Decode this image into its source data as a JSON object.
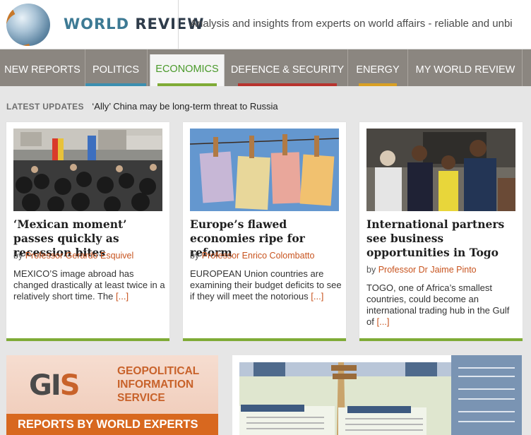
{
  "header": {
    "logo_part1": "WORLD",
    "logo_part2": "REVIEW",
    "tagline": "Analysis and insights from experts on world affairs - reliable and unbi"
  },
  "nav": {
    "items": [
      {
        "label": "NEW REPORTS"
      },
      {
        "label": "POLITICS",
        "bar_color": "#3b8fb0"
      },
      {
        "label": "ECONOMICS",
        "bar_color": "#7fab36"
      },
      {
        "label": "DEFENCE & SECURITY",
        "bar_color": "#b8332e"
      },
      {
        "label": "ENERGY",
        "bar_color": "#d9a023"
      },
      {
        "label": "MY WORLD REVIEW"
      }
    ]
  },
  "latest": {
    "label": "LATEST UPDATES",
    "headline": "‘Ally’ China may be long-term threat to Russia"
  },
  "cards": [
    {
      "title": "‘Mexican moment’ passes quickly as recession bites",
      "by": "by",
      "author": "Professor Gerardo Esquivel",
      "excerpt": "MEXICO’S image abroad has changed drastically at least twice in a relatively short time. The",
      "more": "[...]"
    },
    {
      "title": "Europe’s flawed economies ripe for reform",
      "by": "by",
      "author": "Professor Enrico Colombatto",
      "excerpt": "EUROPEAN Union countries are examining their budget deficits to see if they will meet the notorious",
      "more": "[...]"
    },
    {
      "title": "International partners see business opportunities in Togo",
      "by": "by",
      "author": "Professor Dr Jaime Pinto",
      "excerpt": "TOGO, one of Africa’s smallest countries, could become an international trading hub in the Gulf of",
      "more": "[...]"
    }
  ],
  "banners": {
    "gis_logo_a": "GI",
    "gis_logo_b": "S",
    "gis_line1": "GEOPOLITICAL",
    "gis_line2": "INFORMATION",
    "gis_line3": "SERVICE",
    "gis_strip": "REPORTS BY WORLD EXPERTS"
  },
  "colors": {
    "accent_green": "#7fab36",
    "author_orange": "#c8541f",
    "nav_bg": "#8b8680"
  }
}
